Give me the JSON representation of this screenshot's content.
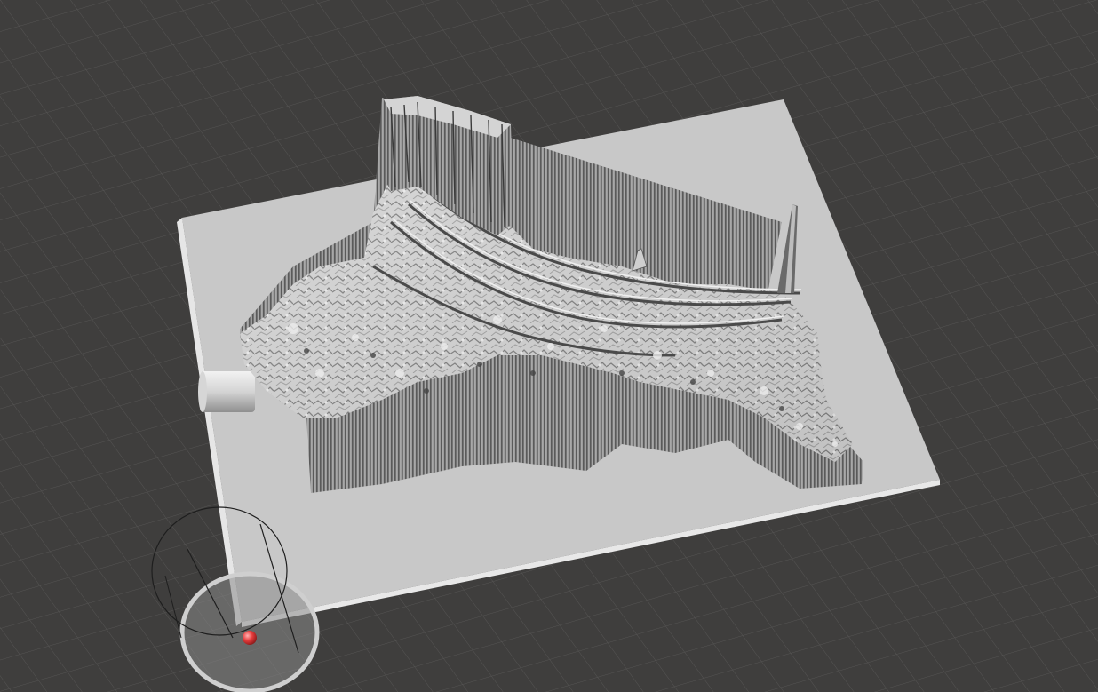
{
  "viewport": {
    "background": "#3f3e3d",
    "grid_color": "#565554",
    "grid_visible": true
  },
  "scene": {
    "base_plate_color": "#c8c8c8",
    "base_plate_edge_color": "#e6e6e6",
    "model_light_color": "#d9d9d9",
    "model_mid_color": "#9a9a9a",
    "model_dark_color": "#555555",
    "peg_color": "#dcdcdc"
  },
  "gizmo": {
    "ring_color": "#1e1e1e",
    "disc_color": "#8a8a8a",
    "disc_rim_color": "#cfcfcf",
    "handle_color": "#e53b3b",
    "icon": "move-gizmo-icon"
  }
}
